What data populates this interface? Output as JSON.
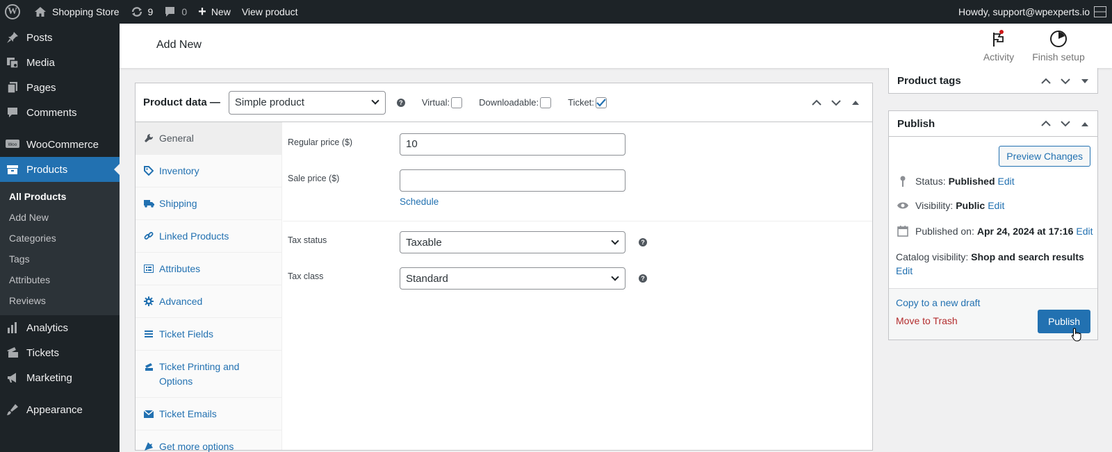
{
  "adminbar": {
    "site_name": "Shopping Store",
    "updates_count": "9",
    "comments_count": "0",
    "new_label": "New",
    "view_product": "View product",
    "howdy": "Howdy, support@wpexperts.io"
  },
  "sidebar": {
    "items": [
      {
        "label": "Posts",
        "icon": "pushpin-icon"
      },
      {
        "label": "Media",
        "icon": "media-icon"
      },
      {
        "label": "Pages",
        "icon": "pages-icon"
      },
      {
        "label": "Comments",
        "icon": "comments-icon"
      },
      {
        "label": "WooCommerce",
        "icon": "woocommerce-icon"
      },
      {
        "label": "Products",
        "icon": "products-icon"
      },
      {
        "label": "Analytics",
        "icon": "analytics-icon"
      },
      {
        "label": "Tickets",
        "icon": "tickets-icon"
      },
      {
        "label": "Marketing",
        "icon": "marketing-icon"
      },
      {
        "label": "Appearance",
        "icon": "appearance-icon"
      }
    ],
    "submenu": [
      "All Products",
      "Add New",
      "Categories",
      "Tags",
      "Attributes",
      "Reviews"
    ]
  },
  "header": {
    "title": "Add New",
    "activity": "Activity",
    "finish_setup": "Finish setup"
  },
  "product_data": {
    "title": "Product data —",
    "type_selected": "Simple product",
    "virtual_label": "Virtual:",
    "downloadable_label": "Downloadable:",
    "ticket_label": "Ticket:",
    "virtual_checked": false,
    "downloadable_checked": false,
    "ticket_checked": true,
    "tabs": [
      {
        "label": "General",
        "icon": "wrench-icon"
      },
      {
        "label": "Inventory",
        "icon": "tag-icon"
      },
      {
        "label": "Shipping",
        "icon": "truck-icon"
      },
      {
        "label": "Linked Products",
        "icon": "link-icon"
      },
      {
        "label": "Attributes",
        "icon": "list-view-icon"
      },
      {
        "label": "Advanced",
        "icon": "gear-icon"
      },
      {
        "label": "Ticket Fields",
        "icon": "menu-lines-icon"
      },
      {
        "label": "Ticket Printing and Options",
        "icon": "printer-icon"
      },
      {
        "label": "Ticket Emails",
        "icon": "email-icon"
      },
      {
        "label": "Get more options",
        "icon": "plugin-icon"
      }
    ],
    "regular_price_label": "Regular price ($)",
    "regular_price_value": "10",
    "sale_price_label": "Sale price ($)",
    "sale_price_value": "",
    "schedule_link": "Schedule",
    "tax_status_label": "Tax status",
    "tax_status_value": "Taxable",
    "tax_class_label": "Tax class",
    "tax_class_value": "Standard"
  },
  "product_tags": {
    "title": "Product tags"
  },
  "publish": {
    "title": "Publish",
    "preview_button": "Preview Changes",
    "status_label": "Status:",
    "status_value": "Published",
    "visibility_label": "Visibility:",
    "visibility_value": "Public",
    "published_on_label": "Published on:",
    "published_on_value": "Apr 24, 2024 at 17:16",
    "catalog_label": "Catalog visibility:",
    "catalog_value": "Shop and search results",
    "edit_link": "Edit",
    "copy_draft": "Copy to a new draft",
    "trash": "Move to Trash",
    "publish_button": "Publish"
  },
  "colors": {
    "admin_dark": "#1d2327",
    "accent": "#2271b1",
    "trash_red": "#b32d2e"
  }
}
